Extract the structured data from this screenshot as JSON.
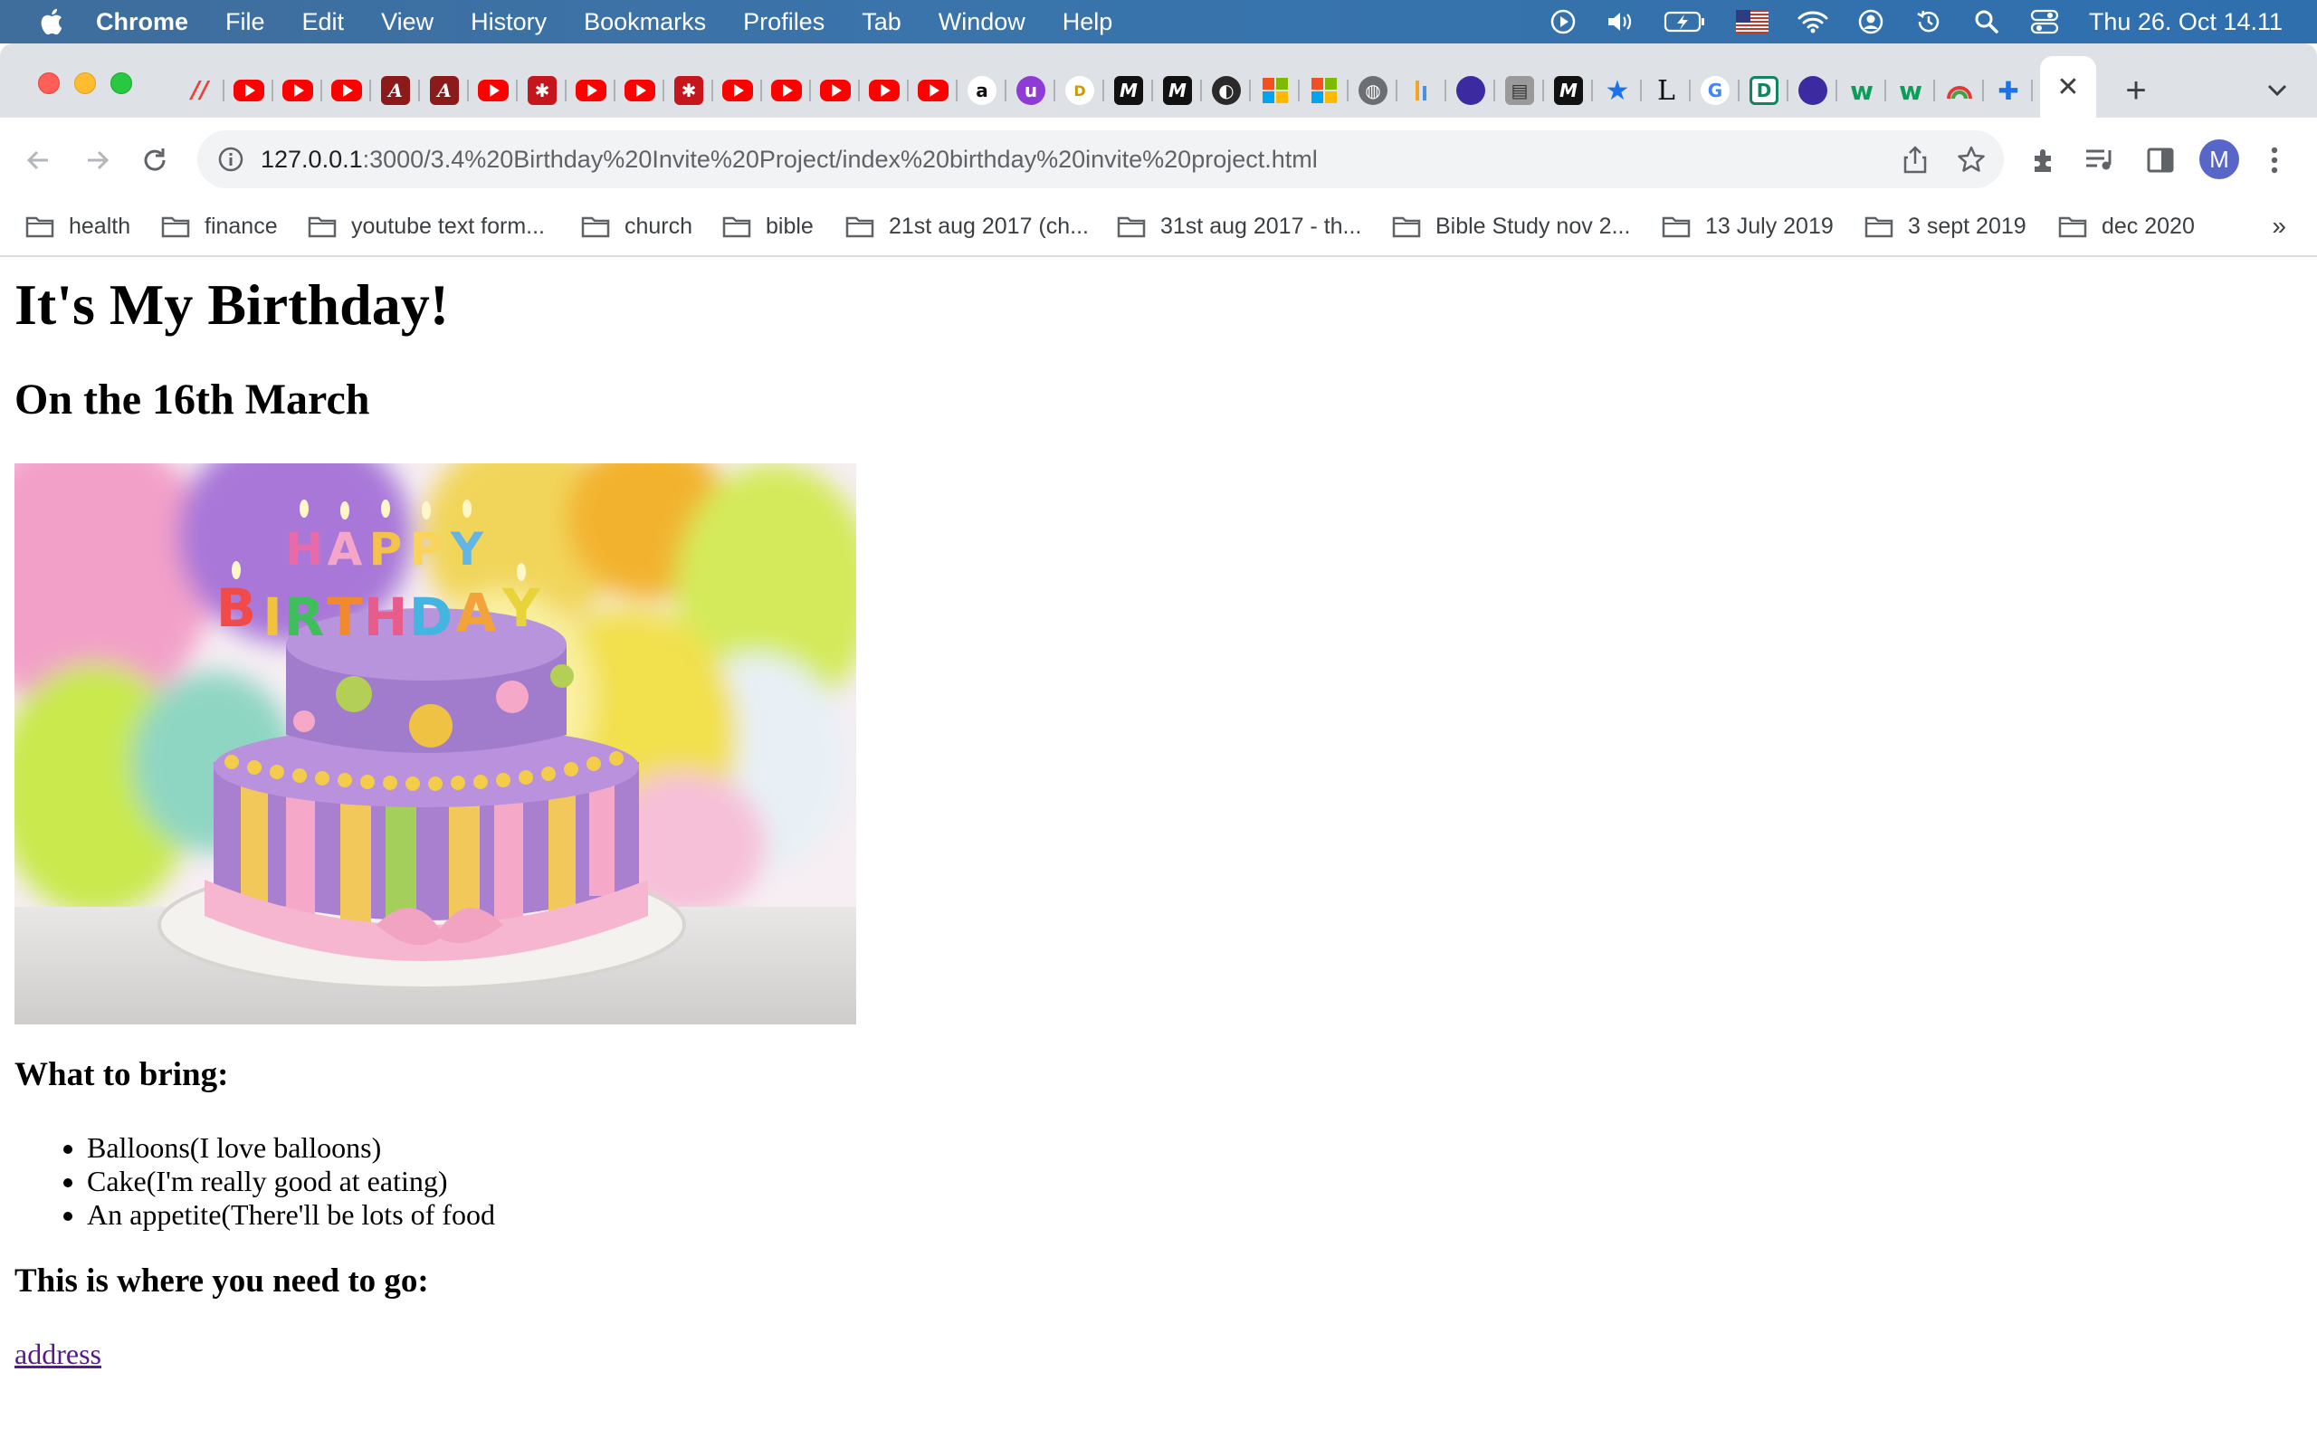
{
  "menubar": {
    "app_name": "Chrome",
    "menus": [
      "File",
      "Edit",
      "View",
      "History",
      "Bookmarks",
      "Profiles",
      "Tab",
      "Window",
      "Help"
    ],
    "clock": "Thu 26. Oct  14.11",
    "status_icons": [
      "play-icon",
      "volume-icon",
      "battery-icon",
      "us-flag-icon",
      "wifi-icon",
      "user-icon",
      "time-machine-icon",
      "spotlight-icon",
      "control-center-icon"
    ]
  },
  "tabs": {
    "favicons": [
      "airtable",
      "youtube",
      "youtube",
      "youtube",
      "script-a",
      "script-a",
      "youtube",
      "asterisk-red",
      "youtube",
      "youtube",
      "asterisk-red",
      "youtube",
      "youtube",
      "youtube",
      "youtube",
      "youtube",
      "amazon",
      "u-purple",
      "d-badge",
      "m-black",
      "m-black",
      "globe-dark",
      "microsoft",
      "microsoft",
      "globe-grey",
      "bar-chart",
      "chat-bubble",
      "notebook",
      "m-black",
      "star-blue",
      "L-serif",
      "google",
      "D-green",
      "chat-bubble",
      "w-green",
      "w-green",
      "chrome-rainbow",
      "puzzle",
      "hubspot"
    ],
    "active_close": "✕",
    "new_tab": "+"
  },
  "toolbar": {
    "url_host": "127.0.0.1",
    "url_rest": ":3000/3.4%20Birthday%20Invite%20Project/index%20birthday%20invite%20project.html",
    "avatar_letter": "M"
  },
  "bookmarks": [
    "health",
    "finance",
    "youtube text form...",
    "church",
    "bible",
    "21st aug 2017 (ch...",
    "31st aug 2017 - th...",
    "Bible Study nov 2...",
    "13 July 2019",
    "3 sept 2019",
    "dec 2020"
  ],
  "bookmarks_more": "»",
  "page": {
    "title": "It's My Birthday!",
    "date": "On the 16th March",
    "cake_letters": "HAPPY BIRTHDAY",
    "bring_heading": "What to bring:",
    "bring_items": [
      "Balloons(I love balloons)",
      "Cake(I'm really good at eating)",
      "An appetite(There'll be lots of food"
    ],
    "go_heading": "This is where you need to go:",
    "address_link": "address"
  },
  "colors": {
    "menubar": "#3a74ab",
    "tabstrip": "#dee1e6",
    "link_visited": "#551a8b",
    "avatar": "#5865c9"
  }
}
